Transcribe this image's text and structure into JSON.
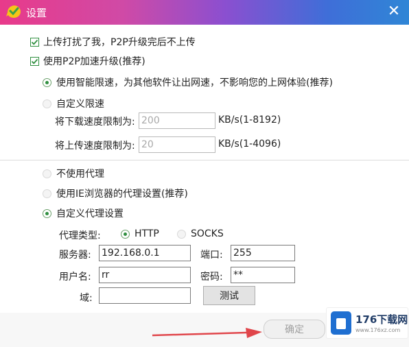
{
  "window": {
    "title": "设置",
    "close_glyph": "✕"
  },
  "options": {
    "upload_disturb": "上传打扰了我，P2P升级完后不上传",
    "p2p_accel": "使用P2P加速升级(推荐)",
    "smart_limit": "使用智能限速，为其他软件让出网速，不影响您的上网体验(推荐)",
    "custom_limit": "自定义限速",
    "download_limit_label": "将下载速度限制为:",
    "download_limit_value": "200",
    "download_limit_unit": "KB/s(1-8192)",
    "upload_limit_label": "将上传速度限制为:",
    "upload_limit_value": "20",
    "upload_limit_unit": "KB/s(1-4096)"
  },
  "proxy": {
    "none": "不使用代理",
    "ie": "使用IE浏览器的代理设置(推荐)",
    "custom": "自定义代理设置",
    "type_label": "代理类型:",
    "type_http": "HTTP",
    "type_socks": "SOCKS",
    "server_label": "服务器:",
    "server_value": "192.168.0.1",
    "port_label": "端口:",
    "port_value": "255",
    "username_label": "用户名:",
    "username_value": "rr",
    "password_label": "密码:",
    "password_value": "**",
    "domain_label": "域:",
    "domain_value": "",
    "test_button": "测试"
  },
  "footer": {
    "ok_button": "确定"
  },
  "watermark": {
    "brand": "176下载网",
    "url": "www.176xz.com"
  },
  "colors": {
    "accent_green": "#2f8f3f",
    "arrow_red": "#e0454a"
  }
}
